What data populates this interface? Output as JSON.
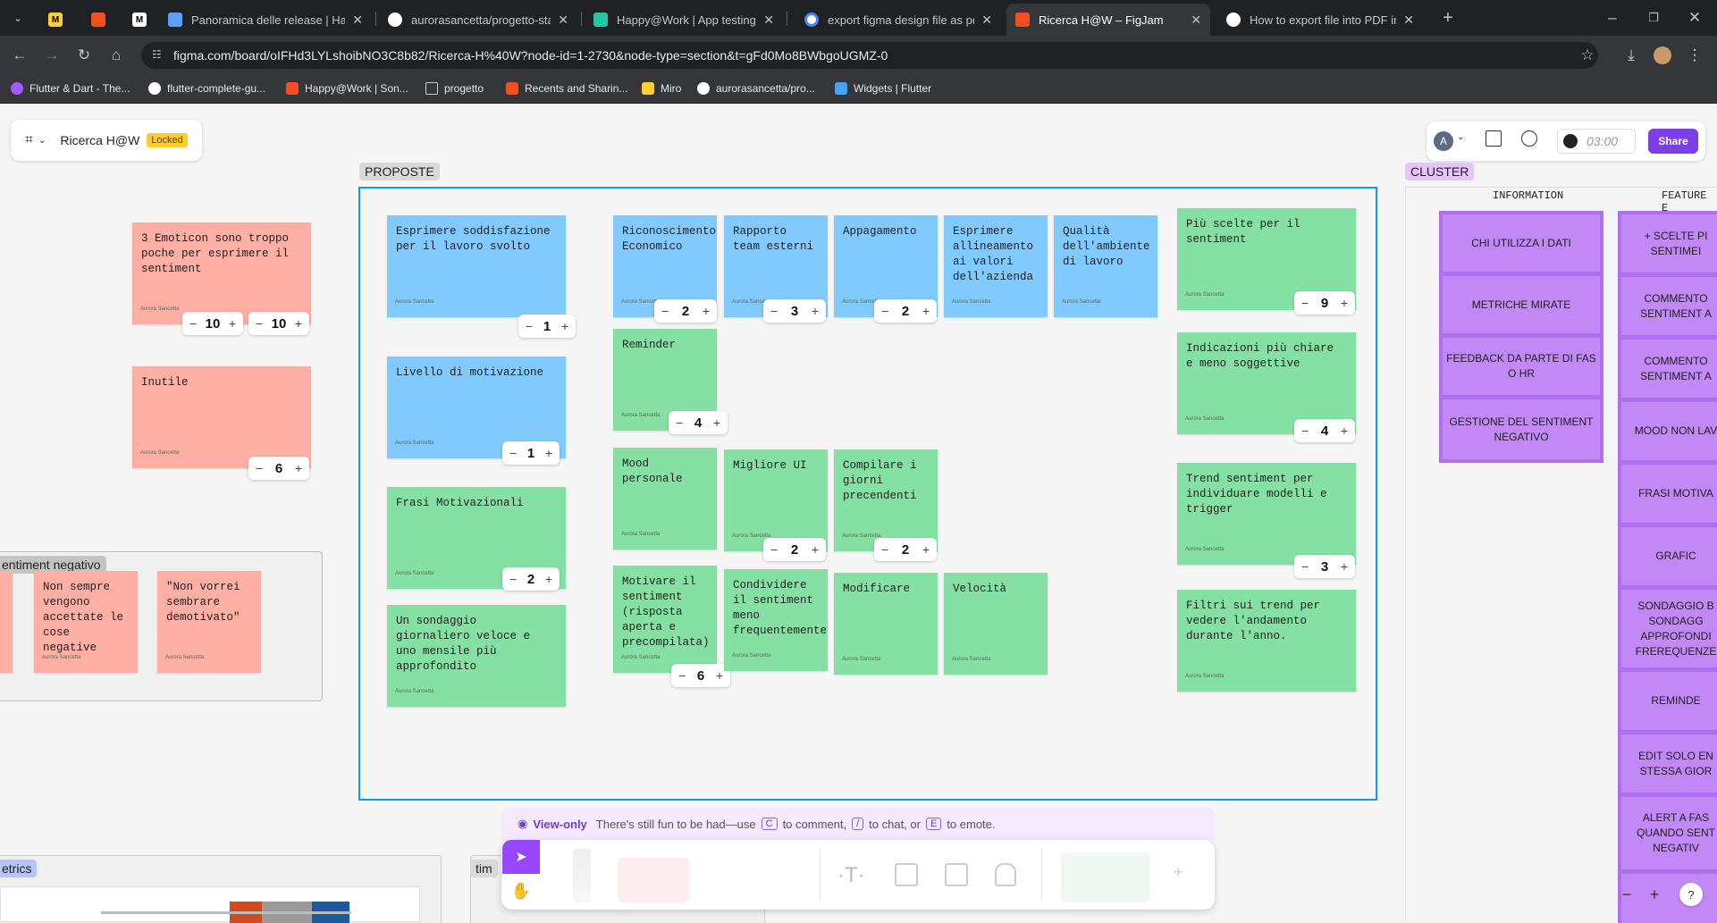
{
  "browser": {
    "tabs": [
      {
        "title": "Panoramica delle release | Happ",
        "color": "#5aa0ff"
      },
      {
        "title": "aurorasancetta/progetto-stage",
        "color": "#ffffff"
      },
      {
        "title": "Happy@Work | App testing",
        "color": "#23c4a8"
      },
      {
        "title": "export figma design file as pdf",
        "color": "#4285f4"
      },
      {
        "title": "Ricerca H@W – FigJam",
        "color": "#f24e1e"
      },
      {
        "title": "How to export file into PDF in F",
        "color": "#ffffff"
      }
    ],
    "new_tab": "+",
    "url": "figma.com/board/oIFHd3LYLshoibNO3C8b82/Ricerca-H%40W?node-id=1-2730&node-type=section&t=gFd0Mo8BWbgoUGMZ-0",
    "bookmarks": [
      {
        "label": "Flutter & Dart - The...",
        "color": "#a259ff"
      },
      {
        "label": "flutter-complete-gu...",
        "color": "#ffffff"
      },
      {
        "label": "Happy@Work | Son...",
        "color": "#f24e1e"
      },
      {
        "label": "progetto",
        "color": "#888888"
      },
      {
        "label": "Recents and Sharin...",
        "color": "#f24e1e"
      },
      {
        "label": "Miro",
        "color": "#ffd02f"
      },
      {
        "label": "aurorasancetta/pro...",
        "color": "#ffffff"
      },
      {
        "label": "Widgets | Flutter",
        "color": "#42a5f5"
      }
    ]
  },
  "figjam": {
    "file_name": "Ricerca H@W",
    "locked_badge": "Locked",
    "avatar": "A",
    "timer": "03:00",
    "share": "Share",
    "sections": {
      "proposte": "PROPOSTE",
      "cluster": "CLUSTER",
      "sentiment": "entiment negativo",
      "metrics": "etrics",
      "time": "tim"
    },
    "left_stickies": [
      {
        "text": "3 Emoticon sono troppo poche per esprimere il sentiment",
        "author": "Aurora Sancetta"
      },
      {
        "text": "Inutile",
        "author": "Aurora Sancetta"
      }
    ],
    "left_counters": [
      "10",
      "10",
      "6"
    ],
    "sentiment_stickies": [
      {
        "text": "Non sempre vengono accettate le cose negative",
        "author": "Aurora Sancetta"
      },
      {
        "text": "\"Non vorrei sembrare demotivato\"",
        "author": "Aurora Sancetta"
      }
    ],
    "proposte_stickies": [
      {
        "text": "Esprimere soddisfazione per il lavoro svolto",
        "author": "Aurora Sancetta",
        "counter": "1"
      },
      {
        "text": "Livello di motivazione",
        "author": "Aurora Sancetta",
        "counter": "1"
      },
      {
        "text": "Frasi Motivazionali",
        "author": "Aurora Sancetta",
        "counter": "2"
      },
      {
        "text": "Un sondaggio giornaliero veloce e uno mensile più approfondito",
        "author": "Aurora Sancetta"
      },
      {
        "text": "Riconoscimento Economico",
        "author": "Aurora Sancetta",
        "counter": "2"
      },
      {
        "text": "Rapporto team esterni",
        "author": "Aurora Sancetta",
        "counter": "3"
      },
      {
        "text": "Appagamento",
        "author": "Aurora Sancetta",
        "counter": "2"
      },
      {
        "text": "Esprimere allineamento ai valori dell'azienda",
        "author": "Aurora Sancetta"
      },
      {
        "text": "Qualità dell'ambiente di lavoro",
        "author": "Aurora Sancetta"
      },
      {
        "text": "Reminder",
        "author": "Aurora Sancetta",
        "counter": "4"
      },
      {
        "text": "Mood personale",
        "author": "Aurora Sancetta"
      },
      {
        "text": "Migliore UI",
        "author": "Aurora Sancetta",
        "counter": "2"
      },
      {
        "text": "Compilare i giorni precendenti",
        "author": "Aurora Sancetta",
        "counter": "2"
      },
      {
        "text": "Motivare il sentiment (risposta aperta e precompilata)",
        "author": "Aurora Sancetta",
        "counter": "6"
      },
      {
        "text": "Condividere il sentiment meno frequentemente",
        "author": "Aurora Sancetta"
      },
      {
        "text": "Modificare",
        "author": "Aurora Sancetta"
      },
      {
        "text": "Velocità",
        "author": "Aurora Sancetta"
      },
      {
        "text": "Più scelte per il sentiment",
        "author": "Aurora Sancetta",
        "counter": "9"
      },
      {
        "text": "Indicazioni più chiare e meno soggettive",
        "author": "Aurora Sancetta",
        "counter": "4"
      },
      {
        "text": "Trend sentiment per individuare modelli e trigger",
        "author": "Aurora Sancetta",
        "counter": "3"
      },
      {
        "text": "Filtri sui trend per vedere l'andamento durante l'anno.",
        "author": "Aurora Sancetta"
      }
    ],
    "cluster": {
      "information_header": "INFORMATION",
      "feature_header": "FEATURE E",
      "information": [
        "CHI UTILIZZA I DATI",
        "METRICHE MIRATE",
        "FEEDBACK DA PARTE DI FAS O HR",
        "GESTIONE DEL SENTIMENT NEGATIVO"
      ],
      "feature": [
        "+ SCELTE PI SENTIMEI",
        "COMMENTO SENTIMENT A",
        "COMMENTO SENTIMENT A",
        "MOOD NON LAV",
        "FRASI MOTIVA",
        "GRAFIC",
        "SONDAGGIO B SONDAGG APPROFONDI FREREQUENZE",
        "REMINDE",
        "EDIT SOLO EN STESSA GIOR",
        "ALERT A FAS QUANDO SENT NEGATIV"
      ]
    },
    "viewonly": {
      "label": "View-only",
      "text1": "There's still fun to be had—use",
      "key1": "C",
      "text2": "to comment,",
      "key2": "/",
      "text3": "to chat, or",
      "key3": "E",
      "text4": "to emote."
    },
    "zoom_out": "−",
    "zoom_in": "+",
    "help": "?"
  }
}
